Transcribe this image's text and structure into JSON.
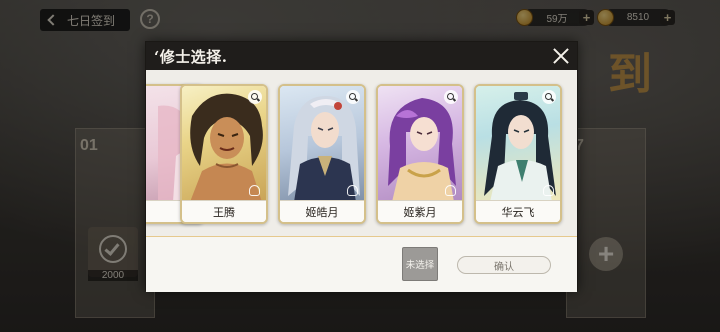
{
  "topbar": {
    "back_label": "七日签到",
    "help_glyph": "?",
    "resources": [
      {
        "icon": "coin-icon",
        "value": "59万"
      },
      {
        "icon": "gold-ingot-icon",
        "value": "8510"
      }
    ]
  },
  "background": {
    "day_left_number": "01",
    "day_left_claim_amount": "2000",
    "day_right_number": "7",
    "banner_char": "到"
  },
  "modal": {
    "title": "‘修士选择.",
    "cards": [
      {
        "name": "",
        "partial": true
      },
      {
        "name": "王腾"
      },
      {
        "name": "姬皓月"
      },
      {
        "name": "姬紫月"
      },
      {
        "name": "华云飞"
      }
    ],
    "noselect_label": "未选择",
    "confirm_label": "确认"
  },
  "colors": {
    "header_bg": "#1f1d1b",
    "panel_bg": "#efede8",
    "card_border": "#d4c08a",
    "footer_accent": "#e6c98d"
  }
}
